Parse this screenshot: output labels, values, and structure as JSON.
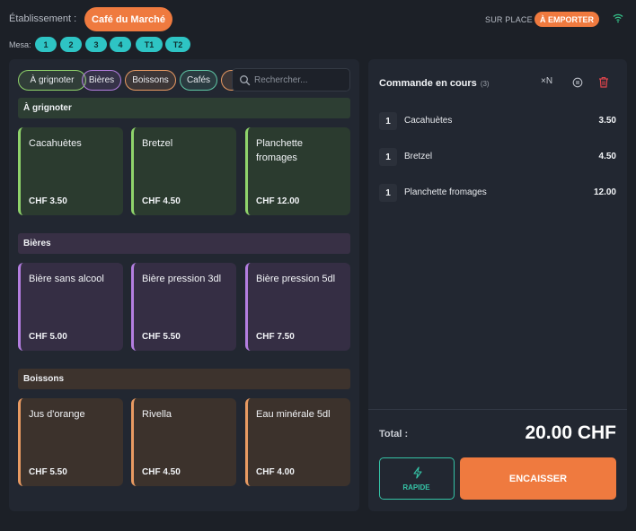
{
  "header": {
    "establishment_label": "Établissement :",
    "establishment_name": "Café du Marché",
    "mode_dine_in": "SUR PLACE",
    "mode_takeaway": "À EMPORTER",
    "wifi_icon": "wifi-icon"
  },
  "mesa": {
    "label": "Mesa:",
    "tables": [
      "1",
      "2",
      "3",
      "4",
      "T1",
      "T2"
    ]
  },
  "categories": [
    {
      "label": "À grignoter",
      "color": "#8fd36b"
    },
    {
      "label": "Bières",
      "color": "#b37ee0"
    },
    {
      "label": "Boissons",
      "color": "#e89a62"
    },
    {
      "label": "Cafés",
      "color": "#5fc6a5"
    }
  ],
  "search": {
    "placeholder": "Rechercher...",
    "icon": "search-icon"
  },
  "sections": [
    {
      "title": "À grignoter",
      "header_bg": "#2d3e33",
      "card_bg": "#2b3b2f",
      "accent": "#8fd36b",
      "products": [
        {
          "name": "Cacahuètes",
          "price": "CHF 3.50"
        },
        {
          "name": "Bretzel",
          "price": "CHF 4.50"
        },
        {
          "name": "Planchette fromages",
          "price": "CHF 12.00"
        }
      ]
    },
    {
      "title": "Bières",
      "header_bg": "#383045",
      "card_bg": "#352e44",
      "accent": "#b37ee0",
      "products": [
        {
          "name": "Bière sans alcool",
          "price": "CHF 5.00"
        },
        {
          "name": "Bière pression 3dl",
          "price": "CHF 5.50"
        },
        {
          "name": "Bière pression 5dl",
          "price": "CHF 7.50"
        }
      ]
    },
    {
      "title": "Boissons",
      "header_bg": "#3d332d",
      "card_bg": "#3c322c",
      "accent": "#e89a62",
      "products": [
        {
          "name": "Jus d'orange",
          "price": "CHF 5.50"
        },
        {
          "name": "Rivella",
          "price": "CHF 4.50"
        },
        {
          "name": "Eau minérale 5dl",
          "price": "CHF 4.00"
        }
      ]
    }
  ],
  "order": {
    "title": "Commande en cours",
    "count": "(3)",
    "multiply_label": "×N",
    "lines": [
      {
        "qty": "1",
        "name": "Cacahuètes",
        "price": "3.50"
      },
      {
        "qty": "1",
        "name": "Bretzel",
        "price": "4.50"
      },
      {
        "qty": "1",
        "name": "Planchette fromages",
        "price": "12.00"
      }
    ],
    "total_label": "Total :",
    "total_value": "20.00 CHF",
    "rapide_label": "RAPIDE",
    "encaisser_label": "ENCAISSER"
  },
  "colors": {
    "brand_orange": "#ef7a3f",
    "mesa_teal": "#2ec4c4",
    "rapide_green": "#35c3a6",
    "trash_red": "#e0454c"
  }
}
